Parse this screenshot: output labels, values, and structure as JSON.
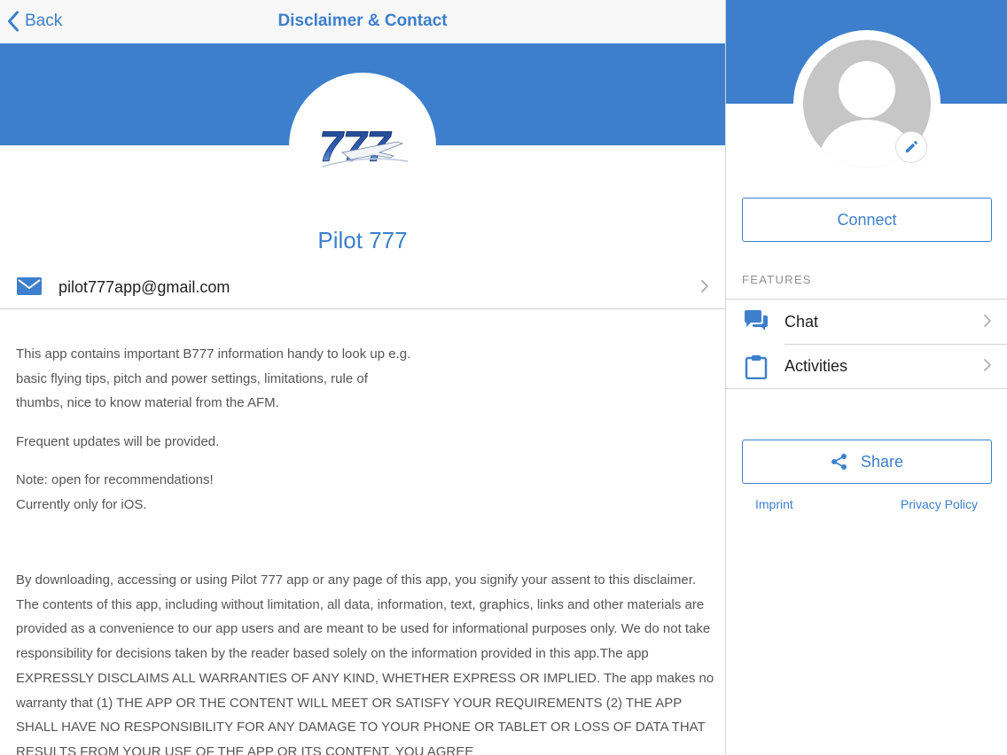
{
  "navbar": {
    "back_label": "Back",
    "title": "Disclaimer & Contact"
  },
  "app": {
    "logo_text": "777",
    "name": "Pilot 777"
  },
  "contact": {
    "email": "pilot777app@gmail.com"
  },
  "description": {
    "paragraph1_line1": "This app contains important B777 information handy to look up e.g.",
    "paragraph1_line2": "basic flying tips, pitch and power settings, limitations, rule of",
    "paragraph1_line3": "thumbs, nice to know material from the AFM.",
    "paragraph2": "Frequent updates will be provided.",
    "paragraph3_line1": "Note: open for recommendations!",
    "paragraph3_line2": "Currently only for iOS."
  },
  "disclaimer": {
    "text": "By downloading, accessing or using Pilot 777 app or any page of this app, you signify your assent to this disclaimer. The contents of this app, including without limitation, all data, information, text, graphics, links and other materials are provided as a convenience to our app users and are meant to be used for informational purposes only. We do not take responsibility for decisions taken by the reader based solely on the information provided in this app.The app EXPRESSLY DISCLAIMS ALL WARRANTIES OF ANY KIND, WHETHER EXPRESS OR IMPLIED. The app makes no warranty that (1) THE APP OR THE CONTENT WILL MEET OR SATISFY YOUR REQUIREMENTS (2) THE APP SHALL HAVE NO RESPONSIBILITY FOR ANY DAMAGE TO YOUR PHONE OR TABLET OR LOSS OF DATA THAT RESULTS FROM YOUR USE OF THE APP OR ITS CONTENT. YOU AGREE"
  },
  "profile_panel": {
    "connect_label": "Connect",
    "features_heading": "FEATURES",
    "features": [
      {
        "label": "Chat",
        "icon": "chat-icon"
      },
      {
        "label": "Activities",
        "icon": "clipboard-icon"
      }
    ],
    "share_label": "Share",
    "imprint_label": "Imprint",
    "privacy_label": "Privacy Policy"
  },
  "colors": {
    "accent": "#3d7fcc",
    "avatar_grey": "#c6c6c6",
    "divider": "#d4d4d4"
  }
}
